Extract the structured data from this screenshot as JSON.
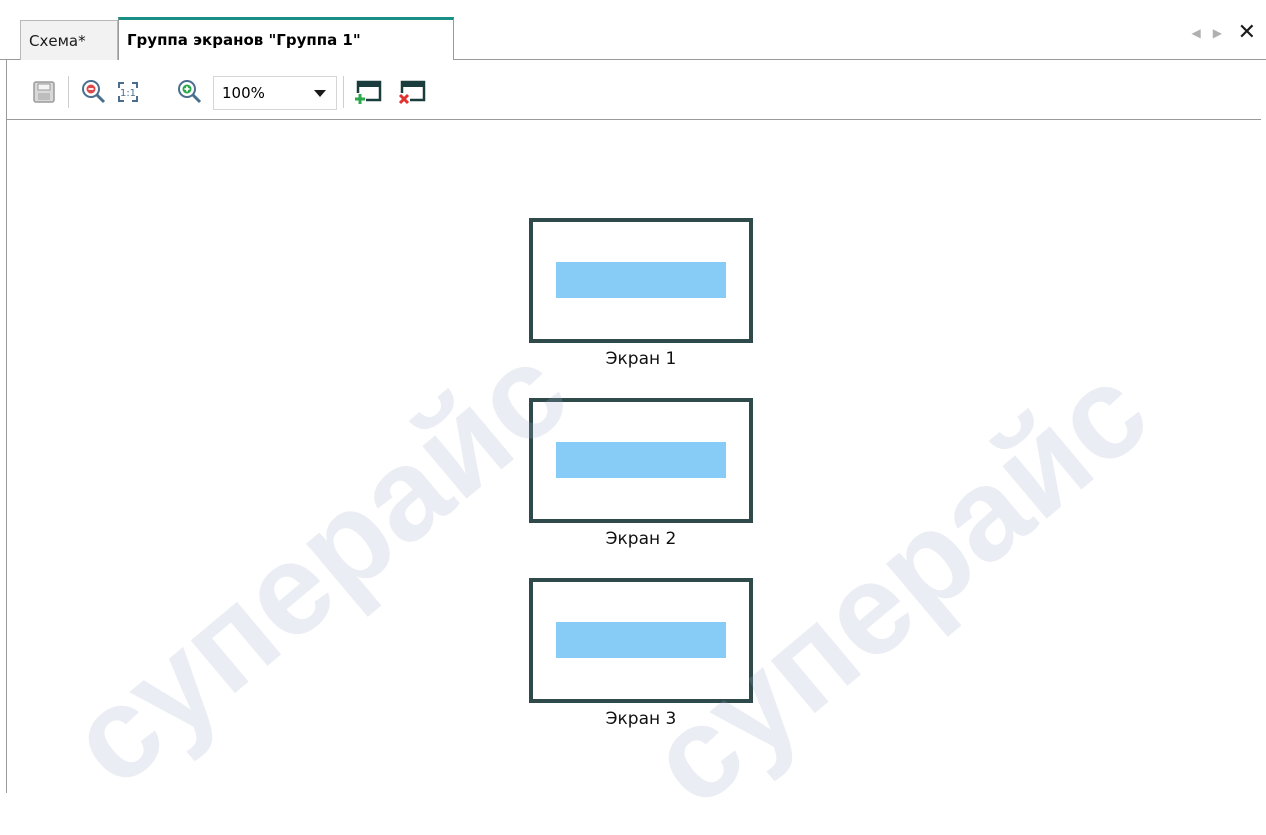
{
  "tabs": [
    {
      "label": "Схема*",
      "active": false
    },
    {
      "label": "Группа экранов \"Группа 1\"",
      "active": true
    }
  ],
  "toolbar": {
    "zoom_value": "100%",
    "icons": [
      "save-icon",
      "zoom-out-icon",
      "actual-size-icon",
      "zoom-in-icon",
      "add-screen-icon",
      "delete-screen-icon"
    ]
  },
  "screens": [
    {
      "label": "Экран 1"
    },
    {
      "label": "Экран 2"
    },
    {
      "label": "Экран 3"
    }
  ],
  "watermark": "суперайс",
  "colors": {
    "accent": "#1a8f85",
    "thumb_border": "#2e4a4a",
    "thumb_bar": "#87cbf7"
  }
}
